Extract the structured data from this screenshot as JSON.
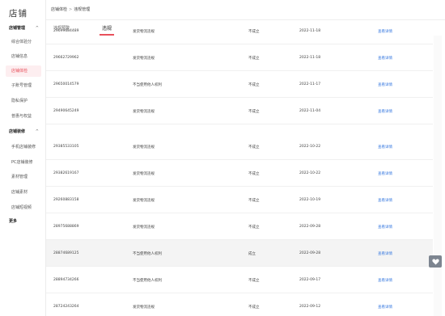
{
  "app": {
    "title": "店铺"
  },
  "breadcrumb": {
    "parent": "店铺体检",
    "separator": ">",
    "current": "违规管理"
  },
  "sidebar": {
    "groups": [
      {
        "label": "店铺管理",
        "caret": "^",
        "items": [
          {
            "label": "综合体验分",
            "active": false
          },
          {
            "label": "店铺信息",
            "active": false
          },
          {
            "label": "店铺体检",
            "active": true
          },
          {
            "label": "子账号管理",
            "active": false
          },
          {
            "label": "隐私保护",
            "active": false
          },
          {
            "label": "普惠与权益",
            "active": false
          }
        ]
      },
      {
        "label": "店铺装修",
        "caret": "^",
        "items": [
          {
            "label": "手机店铺装修",
            "active": false
          },
          {
            "label": "PC店铺装修",
            "active": false
          },
          {
            "label": "素材管理",
            "active": false
          },
          {
            "label": "店铺素材",
            "active": false
          },
          {
            "label": "店铺短视频",
            "active": false
          }
        ]
      }
    ],
    "more": "更多"
  },
  "tabs": [
    {
      "label": "违规预警",
      "active": false
    },
    {
      "label": "违规",
      "active": true
    }
  ],
  "table": {
    "link_label": "查看详情",
    "rows": [
      {
        "id": "29699684489",
        "reason": "发货物流违规",
        "result": "不成立",
        "date": "2022-11-18"
      },
      {
        "id": "29662729962",
        "reason": "发货物流违规",
        "result": "不成立",
        "date": "2022-11-18"
      },
      {
        "id": "29650014579",
        "reason": "不当使用他人权利",
        "result": "不成立",
        "date": "2022-11-17"
      },
      {
        "id": "29490645249",
        "reason": "发货物流违规",
        "result": "不成立",
        "date": "2022-11-04"
      },
      {
        "id": "29385533105",
        "reason": "发货物流违规",
        "result": "不成立",
        "date": "2022-10-22"
      },
      {
        "id": "29382619167",
        "reason": "发货物流违规",
        "result": "不成立",
        "date": "2022-10-22"
      },
      {
        "id": "29260883158",
        "reason": "发货物流违规",
        "result": "不成立",
        "date": "2022-10-19"
      },
      {
        "id": "28975688869",
        "reason": "发货物流违规",
        "result": "不成立",
        "date": "2022-09-28"
      },
      {
        "id": "28874689125",
        "reason": "不当使用他人权利",
        "result": "成立",
        "date": "2022-09-28",
        "highlight": true
      },
      {
        "id": "28894734266",
        "reason": "不当使用他人权利",
        "result": "不成立",
        "date": "2022-09-17"
      },
      {
        "id": "28724243264",
        "reason": "发货物流违规",
        "result": "不成立",
        "date": "2022-09-12"
      }
    ]
  },
  "floating": {
    "icon": "heart-icon"
  }
}
